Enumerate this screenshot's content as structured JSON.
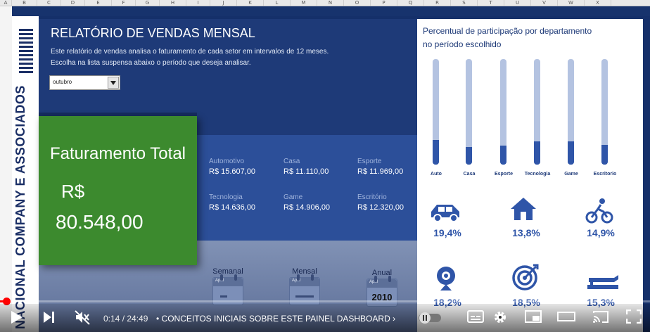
{
  "spreadsheet": {
    "columns": [
      "A",
      "B",
      "C",
      "D",
      "E",
      "F",
      "G",
      "H",
      "I",
      "J",
      "K",
      "L",
      "M",
      "N",
      "O",
      "P",
      "Q",
      "R",
      "S",
      "T",
      "U",
      "V",
      "W",
      "X"
    ]
  },
  "brand": {
    "name": "NACIONAL COMPANY E ASSOCIADOS"
  },
  "header": {
    "title": "RELATÓRIO DE VENDAS MENSAL",
    "line1": "Este relatório de vendas analisa o faturamento de cada setor em intervalos de 12 meses.",
    "line2": "Escolha na lista suspensa abaixo o período que deseja analisar.",
    "dropdown_value": "outubro"
  },
  "total": {
    "label": "Faturamento Total",
    "currency": "R$",
    "value": "80.548,00"
  },
  "sectors": [
    {
      "name": "Automotivo",
      "value": "R$ 15.607,00"
    },
    {
      "name": "Casa",
      "value": "R$ 11.110,00"
    },
    {
      "name": "Esporte",
      "value": "R$ 11.969,00"
    },
    {
      "name": "Tecnologia",
      "value": "R$ 14.636,00"
    },
    {
      "name": "Game",
      "value": "R$ 14.906,00"
    },
    {
      "name": "Escritório",
      "value": "R$ 12.320,00"
    }
  ],
  "periods": [
    {
      "label": "Semanal",
      "month": "April"
    },
    {
      "label": "Mensal",
      "month": "April"
    },
    {
      "label": "Anual",
      "month": "April",
      "year": "2010"
    }
  ],
  "participation": {
    "title_line1": "Percentual de participação por departamento",
    "title_line2": "no período escolhido",
    "departments": [
      {
        "short": "Auto",
        "icon": "car-icon",
        "percent": "19,4%",
        "fraction": 0.194
      },
      {
        "short": "Casa",
        "icon": "house-icon",
        "percent": "13,8%",
        "fraction": 0.138
      },
      {
        "short": "Esporte",
        "icon": "cyclist-icon",
        "percent": "14,9%",
        "fraction": 0.149
      },
      {
        "short": "Tecnologia",
        "icon": "webcam-icon",
        "percent": "18,2%",
        "fraction": 0.182
      },
      {
        "short": "Game",
        "icon": "target-icon",
        "percent": "18,5%",
        "fraction": 0.185
      },
      {
        "short": "Escritorio",
        "icon": "stapler-icon",
        "percent": "15,3%",
        "fraction": 0.153
      }
    ]
  },
  "video": {
    "time": "0:14 / 24:49",
    "chapter": "CONCEITOS INICIAIS SOBRE ESTE PAINEL DASHBOARD",
    "progress": 0.0094
  },
  "colors": {
    "panel_dark": "#1e3a78",
    "total_green": "#3c8a2e",
    "accent_blue": "#2f55a8"
  }
}
